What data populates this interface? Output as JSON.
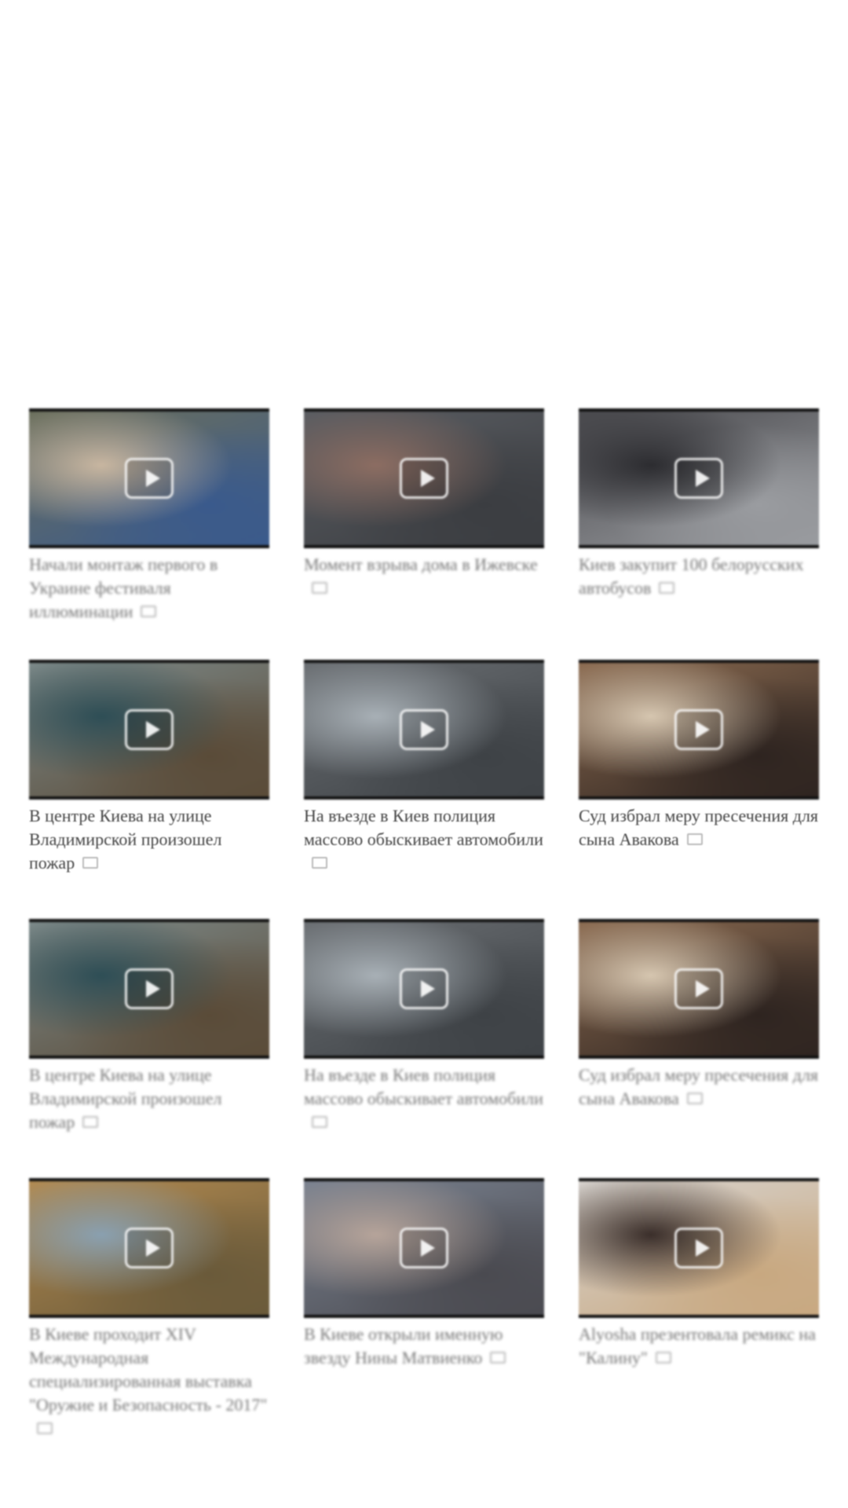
{
  "videos": [
    {
      "title": "Начали монтаж первого в Украине фестиваля иллюминации",
      "thumb_icon": "play-icon",
      "colors": [
        "#6b6f5c",
        "#3a5a8c",
        "#c8b6a0"
      ]
    },
    {
      "title": "Момент взрыва дома в Ижевске",
      "thumb_icon": "play-icon",
      "colors": [
        "#5a5d62",
        "#3b3d41",
        "#8c6d62"
      ]
    },
    {
      "title": "Киев закупит 100 белорусских автобусов",
      "thumb_icon": "play-icon",
      "colors": [
        "#4a4a4e",
        "#9a9ca0",
        "#2c2c30"
      ]
    },
    {
      "title": "В центре Киева на улице Владимирской произошел пожар",
      "thumb_icon": "play-icon",
      "colors": [
        "#7d8a8a",
        "#5a4b38",
        "#2e4e56"
      ]
    },
    {
      "title": "На въезде в Киев полиция массово обыскивает автомобили",
      "thumb_icon": "play-icon",
      "colors": [
        "#6a6e72",
        "#3e4246",
        "#a8b0b6"
      ]
    },
    {
      "title": "Суд избрал меру пресечения для сына Авакова",
      "thumb_icon": "play-icon",
      "colors": [
        "#8a6a50",
        "#2e2420",
        "#d6c6b0"
      ]
    },
    {
      "title": "В центре Киева на улице Владимирской произошел пожар",
      "thumb_icon": "play-icon",
      "colors": [
        "#7d8a8a",
        "#5a4b38",
        "#2e4e56"
      ]
    },
    {
      "title": "На въезде в Киев полиция массово обыскивает автомобили",
      "thumb_icon": "play-icon",
      "colors": [
        "#6a6e72",
        "#3e4246",
        "#a8b0b6"
      ]
    },
    {
      "title": "Суд избрал меру пресечения для сына Авакова",
      "thumb_icon": "play-icon",
      "colors": [
        "#8a6a50",
        "#2e2420",
        "#d6c6b0"
      ]
    },
    {
      "title": "В Киеве проходит XIV Международная специализированная выставка \"Оружие и Безопасность - 2017\"",
      "thumb_icon": "play-icon",
      "colors": [
        "#b28a50",
        "#6a5a3a",
        "#8aa0b0"
      ]
    },
    {
      "title": "В Киеве открыли именную звезду Нины Матвиенко",
      "thumb_icon": "play-icon",
      "colors": [
        "#7a8290",
        "#4a4a50",
        "#b6a49a"
      ]
    },
    {
      "title": "Alyosha презентовала ремикс на \"Калину\"",
      "thumb_icon": "play-icon",
      "colors": [
        "#d8d4d0",
        "#c8a880",
        "#3a2e2a"
      ]
    }
  ],
  "caption_icon": "video-camera-icon"
}
